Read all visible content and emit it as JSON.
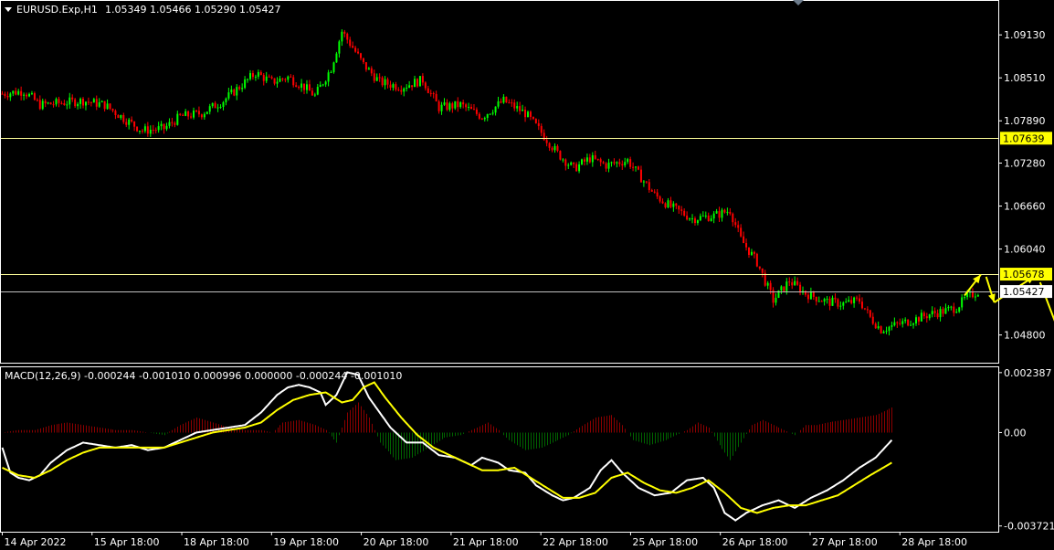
{
  "colors": {
    "background": "#000000",
    "frame": "#ffffff",
    "bull": "#00ff00",
    "bear": "#ff0000",
    "level_line": "#ffff99",
    "bid_line": "#c0c0c0",
    "macd_main": "#ffffff",
    "macd_signal": "#ffff00",
    "hist_pos": "#8b0000",
    "hist_neg": "#006400",
    "arrow": "#ffff00",
    "tag_yellow": "#ffff00",
    "tag_white": "#ffffff"
  },
  "header": {
    "menu_icon": "triangle-down-icon",
    "symbol": "EURUSD.Exp,H1",
    "ohlc": "1.05349 1.05466 1.05290 1.05427"
  },
  "chart_data": [
    {
      "type": "candlestick",
      "symbol": "EURUSD.Exp",
      "timeframe": "H1",
      "x_ticks": [
        "14 Apr 2022",
        "15 Apr 18:00",
        "18 Apr 18:00",
        "19 Apr 18:00",
        "20 Apr 18:00",
        "21 Apr 18:00",
        "22 Apr 18:00",
        "25 Apr 18:00",
        "26 Apr 18:00",
        "27 Apr 18:00",
        "28 Apr 18:00"
      ],
      "y_ticks": [
        "1.09130",
        "1.08510",
        "1.07890",
        "1.07280",
        "1.06660",
        "1.06040",
        "1.04800"
      ],
      "ylim": [
        1.044,
        1.0962
      ],
      "close_path": [
        [
          0,
          1.0828
        ],
        [
          8,
          1.0832
        ],
        [
          14,
          1.0812
        ],
        [
          22,
          1.0815
        ],
        [
          30,
          1.0818
        ],
        [
          38,
          1.0812
        ],
        [
          46,
          1.079
        ],
        [
          52,
          1.0775
        ],
        [
          60,
          1.0778
        ],
        [
          66,
          1.0795
        ],
        [
          74,
          1.08
        ],
        [
          82,
          1.0818
        ],
        [
          88,
          1.0838
        ],
        [
          94,
          1.0858
        ],
        [
          100,
          1.0845
        ],
        [
          106,
          1.0852
        ],
        [
          112,
          1.0838
        ],
        [
          116,
          1.0825
        ],
        [
          122,
          1.0865
        ],
        [
          126,
          1.0918
        ],
        [
          130,
          1.0895
        ],
        [
          134,
          1.087
        ],
        [
          140,
          1.0845
        ],
        [
          148,
          1.0838
        ],
        [
          156,
          1.0848
        ],
        [
          162,
          1.0808
        ],
        [
          170,
          1.0812
        ],
        [
          178,
          1.0795
        ],
        [
          186,
          1.0818
        ],
        [
          194,
          1.08
        ],
        [
          200,
          1.0772
        ],
        [
          206,
          1.0742
        ],
        [
          212,
          1.072
        ],
        [
          218,
          1.0735
        ],
        [
          224,
          1.0725
        ],
        [
          232,
          1.0732
        ],
        [
          236,
          1.0712
        ],
        [
          242,
          1.0682
        ],
        [
          248,
          1.0665
        ],
        [
          256,
          1.0648
        ],
        [
          264,
          1.0652
        ],
        [
          270,
          1.066
        ],
        [
          274,
          1.0618
        ],
        [
          280,
          1.0585
        ],
        [
          286,
          1.053
        ],
        [
          292,
          1.0558
        ],
        [
          298,
          1.054
        ],
        [
          306,
          1.0528
        ],
        [
          312,
          1.0525
        ],
        [
          318,
          1.053
        ],
        [
          322,
          1.0505
        ],
        [
          326,
          1.0488
        ],
        [
          332,
          1.0495
        ],
        [
          338,
          1.0502
        ],
        [
          344,
          1.051
        ],
        [
          350,
          1.0515
        ],
        [
          354,
          1.052
        ],
        [
          358,
          1.0535
        ],
        [
          362,
          1.0543
        ]
      ],
      "horizontal_levels": [
        {
          "price": 1.07639,
          "label": "1.07639",
          "style": "yellow"
        },
        {
          "price": 1.05678,
          "label": "1.05678",
          "style": "yellow"
        }
      ],
      "bid_line": {
        "price": 1.05427,
        "label": "1.05427"
      },
      "forecast_arrows": [
        [
          [
            357,
            1.0537
          ],
          [
            363,
            1.0567
          ]
        ],
        [
          [
            365,
            1.0564
          ],
          [
            368,
            1.0527
          ]
        ],
        [
          [
            368,
            1.0527
          ],
          [
            383,
            1.0565
          ]
        ],
        [
          [
            385,
            1.0556
          ],
          [
            394,
            1.0464
          ]
        ]
      ]
    },
    {
      "type": "macd",
      "title": "MACD(12,26,9) -0.000244 -0.001010 0.000996 0.000000 -0.000244 -0.001010",
      "y_ticks": [
        "0.002387",
        "0.00",
        "-0.003721"
      ],
      "ylim": [
        -0.00395,
        0.0026
      ],
      "main": [
        [
          0,
          -0.0006
        ],
        [
          3,
          -0.0016
        ],
        [
          6,
          -0.0018
        ],
        [
          10,
          -0.0019
        ],
        [
          14,
          -0.0017
        ],
        [
          18,
          -0.0012
        ],
        [
          24,
          -0.0007
        ],
        [
          30,
          -0.0004
        ],
        [
          36,
          -0.0005
        ],
        [
          42,
          -0.0006
        ],
        [
          48,
          -0.0005
        ],
        [
          54,
          -0.0007
        ],
        [
          60,
          -0.0006
        ],
        [
          66,
          -0.0003
        ],
        [
          72,
          0.0
        ],
        [
          78,
          0.0001
        ],
        [
          84,
          0.0002
        ],
        [
          90,
          0.0003
        ],
        [
          96,
          0.0008
        ],
        [
          102,
          0.0015
        ],
        [
          106,
          0.0018
        ],
        [
          110,
          0.0019
        ],
        [
          114,
          0.0018
        ],
        [
          118,
          0.0016
        ],
        [
          120,
          0.0011
        ],
        [
          124,
          0.0015
        ],
        [
          128,
          0.0024
        ],
        [
          132,
          0.0023
        ],
        [
          136,
          0.0014
        ],
        [
          140,
          0.0008
        ],
        [
          144,
          0.0002
        ],
        [
          150,
          -0.0004
        ],
        [
          156,
          -0.0004
        ],
        [
          162,
          -0.0009
        ],
        [
          168,
          -0.001
        ],
        [
          174,
          -0.0013
        ],
        [
          178,
          -0.001
        ],
        [
          184,
          -0.0012
        ],
        [
          188,
          -0.0015
        ],
        [
          194,
          -0.0016
        ],
        [
          198,
          -0.0021
        ],
        [
          204,
          -0.0025
        ],
        [
          208,
          -0.0027
        ],
        [
          212,
          -0.0026
        ],
        [
          218,
          -0.0022
        ],
        [
          222,
          -0.0015
        ],
        [
          226,
          -0.0011
        ],
        [
          230,
          -0.0016
        ],
        [
          236,
          -0.0022
        ],
        [
          242,
          -0.0025
        ],
        [
          248,
          -0.0024
        ],
        [
          254,
          -0.0019
        ],
        [
          260,
          -0.0018
        ],
        [
          264,
          -0.0022
        ],
        [
          268,
          -0.0032
        ],
        [
          272,
          -0.0035
        ],
        [
          276,
          -0.0032
        ],
        [
          282,
          -0.0029
        ],
        [
          288,
          -0.0027
        ],
        [
          294,
          -0.003
        ],
        [
          300,
          -0.0026
        ],
        [
          306,
          -0.0023
        ],
        [
          312,
          -0.0019
        ],
        [
          318,
          -0.0014
        ],
        [
          324,
          -0.001
        ],
        [
          330,
          -0.0003
        ]
      ],
      "signal": [
        [
          0,
          -0.0014
        ],
        [
          6,
          -0.0017
        ],
        [
          12,
          -0.0018
        ],
        [
          18,
          -0.0015
        ],
        [
          24,
          -0.0011
        ],
        [
          30,
          -0.0008
        ],
        [
          36,
          -0.0006
        ],
        [
          42,
          -0.0006
        ],
        [
          48,
          -0.0006
        ],
        [
          54,
          -0.0006
        ],
        [
          60,
          -0.0006
        ],
        [
          66,
          -0.0004
        ],
        [
          72,
          -0.0002
        ],
        [
          78,
          0.0
        ],
        [
          84,
          0.0001
        ],
        [
          90,
          0.0002
        ],
        [
          96,
          0.0004
        ],
        [
          102,
          0.0009
        ],
        [
          108,
          0.0013
        ],
        [
          114,
          0.0015
        ],
        [
          120,
          0.0016
        ],
        [
          126,
          0.0012
        ],
        [
          130,
          0.0013
        ],
        [
          134,
          0.0018
        ],
        [
          138,
          0.002
        ],
        [
          142,
          0.0014
        ],
        [
          148,
          0.0006
        ],
        [
          154,
          -0.0001
        ],
        [
          160,
          -0.0006
        ],
        [
          166,
          -0.0009
        ],
        [
          172,
          -0.0012
        ],
        [
          178,
          -0.0015
        ],
        [
          184,
          -0.0015
        ],
        [
          190,
          -0.0014
        ],
        [
          196,
          -0.0018
        ],
        [
          202,
          -0.0022
        ],
        [
          208,
          -0.0026
        ],
        [
          214,
          -0.0026
        ],
        [
          220,
          -0.0024
        ],
        [
          226,
          -0.0018
        ],
        [
          232,
          -0.0016
        ],
        [
          238,
          -0.002
        ],
        [
          244,
          -0.0023
        ],
        [
          250,
          -0.0024
        ],
        [
          256,
          -0.0022
        ],
        [
          262,
          -0.0019
        ],
        [
          268,
          -0.0024
        ],
        [
          274,
          -0.003
        ],
        [
          280,
          -0.0032
        ],
        [
          286,
          -0.003
        ],
        [
          292,
          -0.0029
        ],
        [
          298,
          -0.0029
        ],
        [
          304,
          -0.0027
        ],
        [
          310,
          -0.0025
        ],
        [
          316,
          -0.0021
        ],
        [
          322,
          -0.0017
        ],
        [
          330,
          -0.0012
        ]
      ],
      "histogram_series": [
        [
          0,
          0.0
        ],
        [
          6,
          0.0001
        ],
        [
          12,
          0.0001
        ],
        [
          18,
          0.0003
        ],
        [
          24,
          0.0004
        ],
        [
          30,
          0.0003
        ],
        [
          36,
          0.0002
        ],
        [
          42,
          0.0001
        ],
        [
          48,
          0.0001
        ],
        [
          54,
          0.0
        ],
        [
          60,
          -0.0001
        ],
        [
          66,
          0.0003
        ],
        [
          72,
          0.0006
        ],
        [
          78,
          0.0004
        ],
        [
          84,
          0.0002
        ],
        [
          90,
          0.0001
        ],
        [
          96,
          0.0001
        ],
        [
          100,
          0.0
        ],
        [
          104,
          0.0004
        ],
        [
          110,
          0.0005
        ],
        [
          116,
          0.0003
        ],
        [
          120,
          0.0001
        ],
        [
          124,
          -0.0004
        ],
        [
          128,
          0.0008
        ],
        [
          132,
          0.0012
        ],
        [
          136,
          0.0006
        ],
        [
          140,
          -0.0004
        ],
        [
          146,
          -0.0011
        ],
        [
          152,
          -0.001
        ],
        [
          158,
          -0.0006
        ],
        [
          164,
          -0.0002
        ],
        [
          170,
          -0.0001
        ],
        [
          176,
          0.0002
        ],
        [
          180,
          0.0004
        ],
        [
          184,
          0.0001
        ],
        [
          188,
          -0.0003
        ],
        [
          194,
          -0.0007
        ],
        [
          200,
          -0.0006
        ],
        [
          206,
          -0.0003
        ],
        [
          210,
          -0.0001
        ],
        [
          214,
          0.0002
        ],
        [
          220,
          0.0006
        ],
        [
          226,
          0.0007
        ],
        [
          230,
          0.0003
        ],
        [
          234,
          -0.0003
        ],
        [
          240,
          -0.0005
        ],
        [
          246,
          -0.0003
        ],
        [
          250,
          -0.0001
        ],
        [
          254,
          0.0001
        ],
        [
          258,
          0.0004
        ],
        [
          262,
          0.0002
        ],
        [
          266,
          -0.0005
        ],
        [
          270,
          -0.0011
        ],
        [
          274,
          -0.0004
        ],
        [
          278,
          0.0003
        ],
        [
          282,
          0.0005
        ],
        [
          286,
          0.0003
        ],
        [
          290,
          0.0001
        ],
        [
          294,
          -0.0001
        ],
        [
          298,
          0.0003
        ],
        [
          302,
          0.0003
        ],
        [
          306,
          0.0004
        ],
        [
          312,
          0.0005
        ],
        [
          318,
          0.0006
        ],
        [
          324,
          0.0007
        ],
        [
          330,
          0.001
        ]
      ]
    }
  ]
}
